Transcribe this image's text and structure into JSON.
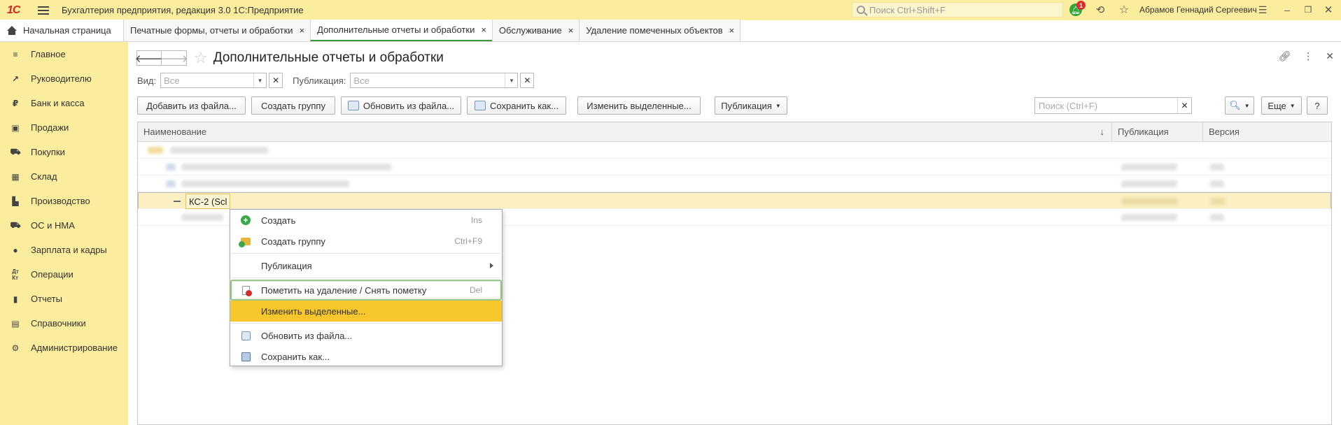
{
  "titlebar": {
    "logo": "1С",
    "app_title": "Бухгалтерия предприятия, редакция 3.0 1С:Предприятие",
    "search_placeholder": "Поиск Ctrl+Shift+F",
    "notification_count": "1",
    "user_name": "Абрамов Геннадий Сергеевич"
  },
  "tabs": {
    "home": "Начальная страница",
    "items": [
      {
        "label": "Печатные формы, отчеты и обработки"
      },
      {
        "label": "Дополнительные отчеты и обработки"
      },
      {
        "label": "Обслуживание"
      },
      {
        "label": "Удаление помеченных объектов"
      }
    ],
    "close_glyph": "×"
  },
  "sidebar": {
    "items": [
      {
        "label": "Главное"
      },
      {
        "label": "Руководителю"
      },
      {
        "label": "Банк и касса"
      },
      {
        "label": "Продажи"
      },
      {
        "label": "Покупки"
      },
      {
        "label": "Склад"
      },
      {
        "label": "Производство"
      },
      {
        "label": "ОС и НМА"
      },
      {
        "label": "Зарплата и кадры"
      },
      {
        "label": "Операции"
      },
      {
        "label": "Отчеты"
      },
      {
        "label": "Справочники"
      },
      {
        "label": "Администрирование"
      }
    ]
  },
  "page": {
    "title": "Дополнительные отчеты и обработки",
    "filters": {
      "view_label": "Вид:",
      "view_placeholder": "Все",
      "publication_label": "Публикация:",
      "publication_placeholder": "Все"
    },
    "toolbar": {
      "add_from_file": "Добавить из файла...",
      "create_group": "Создать группу",
      "update_from_file": "Обновить из файла...",
      "save_as": "Сохранить как...",
      "change_selected": "Изменить выделенные...",
      "publication": "Публикация",
      "search_placeholder": "Поиск (Ctrl+F)",
      "more": "Еще",
      "help": "?"
    },
    "table": {
      "columns": [
        "Наименование",
        "Публикация",
        "Версия"
      ],
      "editing_cell": "КС-2 (Scl"
    }
  },
  "context_menu": {
    "items": [
      {
        "label": "Создать",
        "shortcut": "Ins"
      },
      {
        "label": "Создать группу",
        "shortcut": "Ctrl+F9"
      },
      {
        "label": "Публикация",
        "shortcut": ""
      },
      {
        "label": "Пометить на удаление / Снять пометку",
        "shortcut": "Del"
      },
      {
        "label": "Изменить выделенные...",
        "shortcut": ""
      },
      {
        "label": "Обновить из файла...",
        "shortcut": ""
      },
      {
        "label": "Сохранить как...",
        "shortcut": ""
      }
    ]
  },
  "colors": {
    "sidebar_bg": "#fbed9e",
    "active_tab_underline": "#3c9a3c",
    "menu_highlight": "#f7c72b",
    "selected_row": "#fcefc1"
  }
}
